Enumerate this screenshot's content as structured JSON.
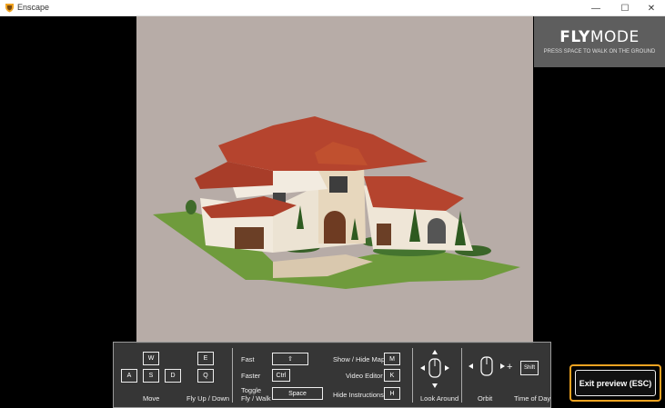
{
  "window": {
    "title": "Enscape",
    "minimize": "—",
    "maximize": "☐",
    "close": "✕"
  },
  "fly_mode": {
    "title_bold": "FLY",
    "title_regular": "MODE",
    "subtitle": "PRESS SPACE TO WALK ON THE GROUND"
  },
  "controls": {
    "move": {
      "keys": [
        "W",
        "A",
        "S",
        "D"
      ],
      "label": "Move"
    },
    "fly": {
      "keys": [
        "E",
        "Q"
      ],
      "label": "Fly Up / Down"
    },
    "fast": {
      "label": "Fast",
      "key": "⇧"
    },
    "faster": {
      "label": "Faster",
      "key": "Ctrl"
    },
    "toggle": {
      "label_line1": "Toggle",
      "label_line2": "Fly / Walk",
      "key": "Space"
    },
    "map": {
      "label": "Show / Hide Map",
      "key": "M"
    },
    "video": {
      "label": "Video Editor",
      "key": "K"
    },
    "instructions": {
      "label": "Hide Instructions",
      "key": "H"
    },
    "look": {
      "label": "Look Around"
    },
    "orbit": {
      "label": "Orbit",
      "plus": "+"
    },
    "time": {
      "label": "Time of Day",
      "key": "Shift"
    }
  },
  "exit_button": {
    "label": "Exit preview (ESC)"
  },
  "colors": {
    "accent": "#f0a321",
    "scene_bg": "#b7aca7",
    "roof": "#b5442e"
  }
}
